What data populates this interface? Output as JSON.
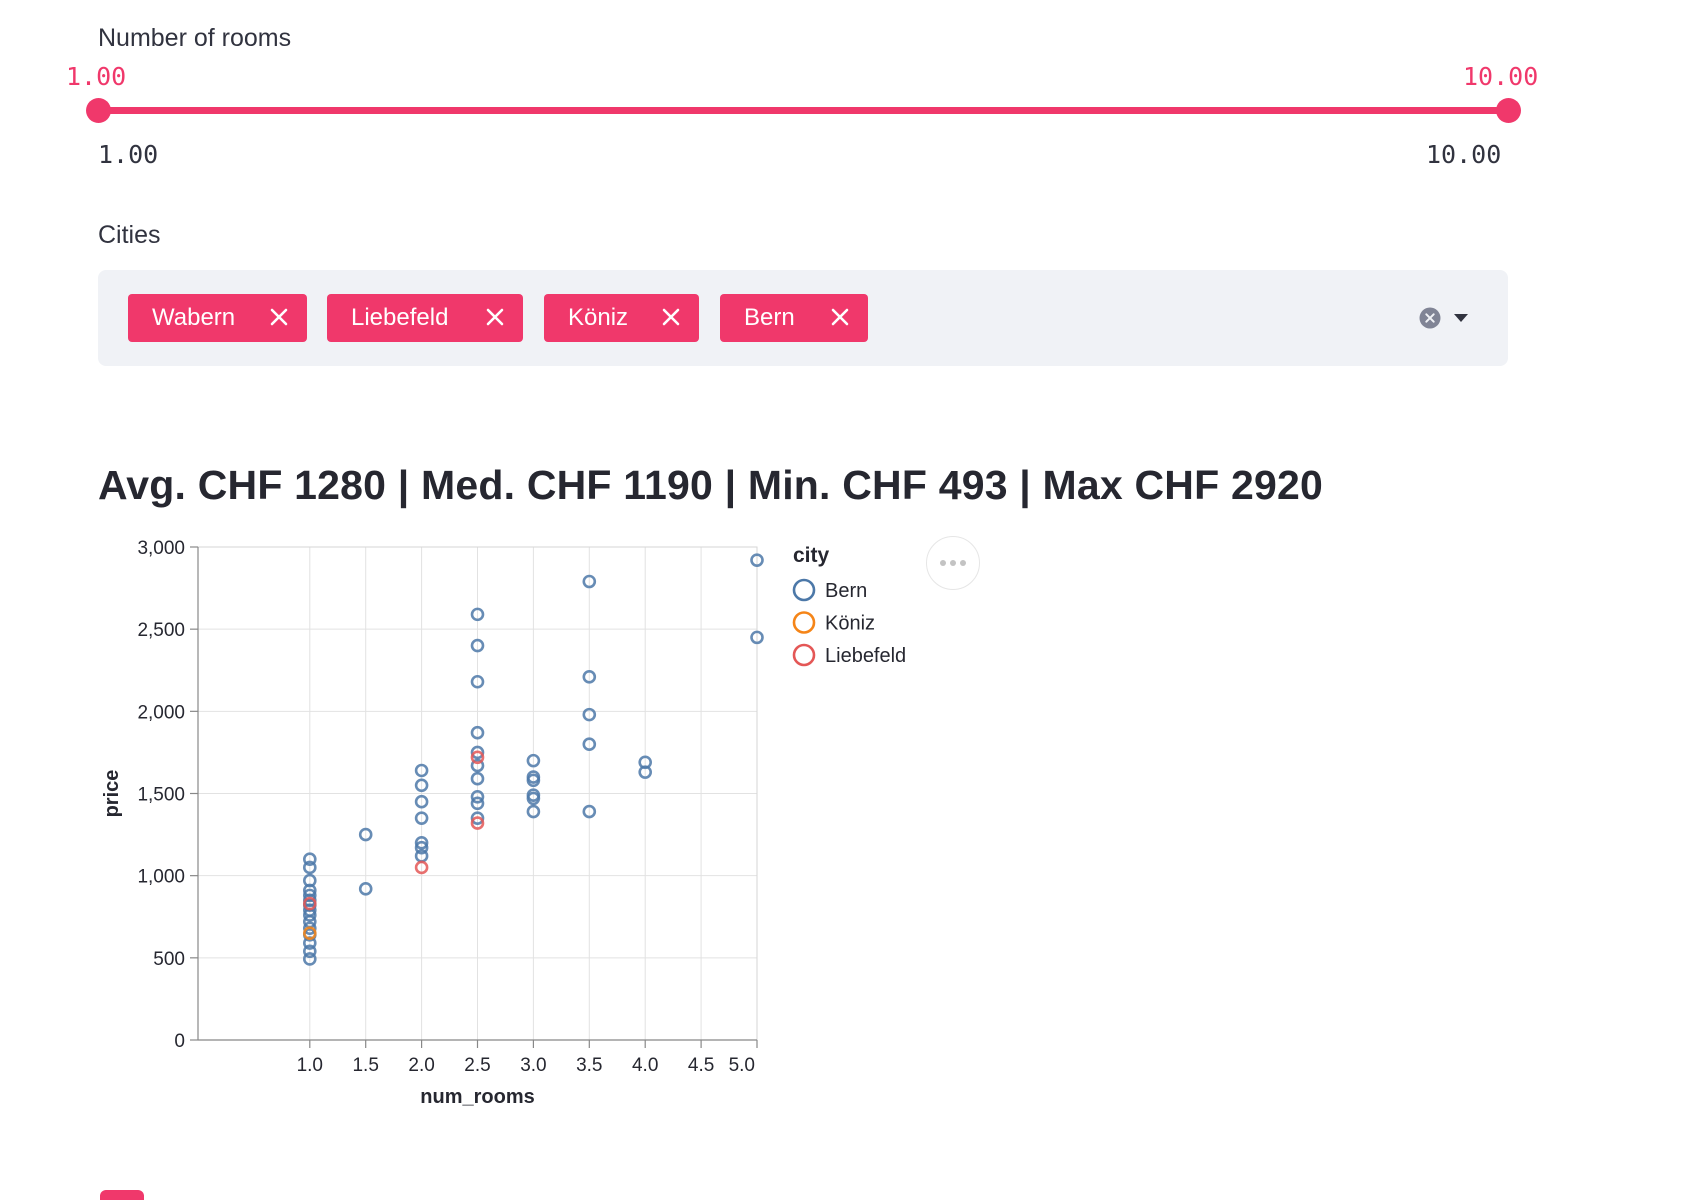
{
  "slider": {
    "label": "Number of rooms",
    "value_min": "1.00",
    "value_max": "10.00",
    "range_min": "1.00",
    "range_max": "10.00",
    "selected_fraction": [
      0.0,
      1.0
    ],
    "accent_color": "#f0386b"
  },
  "multiselect": {
    "label": "Cities",
    "chips": [
      {
        "label": "Wabern"
      },
      {
        "label": "Liebefeld"
      },
      {
        "label": "Köniz"
      },
      {
        "label": "Bern"
      }
    ],
    "clear_icon": "clear-circle-icon",
    "dropdown_icon": "caret-down-icon"
  },
  "stats_heading": "Avg. CHF 1280 | Med. CHF 1190 | Min. CHF 493 | Max CHF 2920",
  "chart_menu_icon": "more-horizontal-icon",
  "chart_data": {
    "type": "scatter",
    "xlabel": "num_rooms",
    "ylabel": "price",
    "xlim": [
      0.0,
      5.0
    ],
    "ylim": [
      0,
      3000
    ],
    "x_ticks": [
      "1.0",
      "1.5",
      "2.0",
      "2.5",
      "3.0",
      "3.5",
      "4.0",
      "4.5",
      "5.0"
    ],
    "y_ticks": [
      "0",
      "500",
      "1,000",
      "1,500",
      "2,000",
      "2,500",
      "3,000"
    ],
    "grid": true,
    "legend": {
      "title": "city",
      "placement": "right",
      "items": [
        {
          "name": "Bern",
          "color": "#4c78a8"
        },
        {
          "name": "Köniz",
          "color": "#f58518"
        },
        {
          "name": "Liebefeld",
          "color": "#e45756"
        }
      ]
    },
    "series": [
      {
        "name": "Bern",
        "color": "#4c78a8",
        "points": [
          [
            1.0,
            493
          ],
          [
            1.0,
            540
          ],
          [
            1.0,
            590
          ],
          [
            1.0,
            640
          ],
          [
            1.0,
            680
          ],
          [
            1.0,
            720
          ],
          [
            1.0,
            760
          ],
          [
            1.0,
            790
          ],
          [
            1.0,
            820
          ],
          [
            1.0,
            850
          ],
          [
            1.0,
            880
          ],
          [
            1.0,
            910
          ],
          [
            1.0,
            970
          ],
          [
            1.0,
            1050
          ],
          [
            1.0,
            1100
          ],
          [
            1.5,
            920
          ],
          [
            1.5,
            1250
          ],
          [
            2.0,
            1120
          ],
          [
            2.0,
            1170
          ],
          [
            2.0,
            1200
          ],
          [
            2.0,
            1350
          ],
          [
            2.0,
            1450
          ],
          [
            2.0,
            1550
          ],
          [
            2.0,
            1640
          ],
          [
            2.5,
            1350
          ],
          [
            2.5,
            1440
          ],
          [
            2.5,
            1480
          ],
          [
            2.5,
            1590
          ],
          [
            2.5,
            1670
          ],
          [
            2.5,
            1750
          ],
          [
            2.5,
            1870
          ],
          [
            2.5,
            2180
          ],
          [
            2.5,
            2400
          ],
          [
            2.5,
            2590
          ],
          [
            3.0,
            1390
          ],
          [
            3.0,
            1470
          ],
          [
            3.0,
            1490
          ],
          [
            3.0,
            1580
          ],
          [
            3.0,
            1600
          ],
          [
            3.0,
            1700
          ],
          [
            3.5,
            1390
          ],
          [
            3.5,
            1800
          ],
          [
            3.5,
            1980
          ],
          [
            3.5,
            2210
          ],
          [
            3.5,
            2790
          ],
          [
            4.0,
            1630
          ],
          [
            4.0,
            1690
          ],
          [
            5.0,
            2450
          ],
          [
            5.0,
            2920
          ]
        ]
      },
      {
        "name": "Köniz",
        "color": "#f58518",
        "points": [
          [
            1.0,
            650
          ]
        ]
      },
      {
        "name": "Liebefeld",
        "color": "#e45756",
        "points": [
          [
            1.0,
            830
          ],
          [
            2.0,
            1050
          ],
          [
            2.5,
            1320
          ],
          [
            2.5,
            1720
          ]
        ]
      }
    ]
  }
}
